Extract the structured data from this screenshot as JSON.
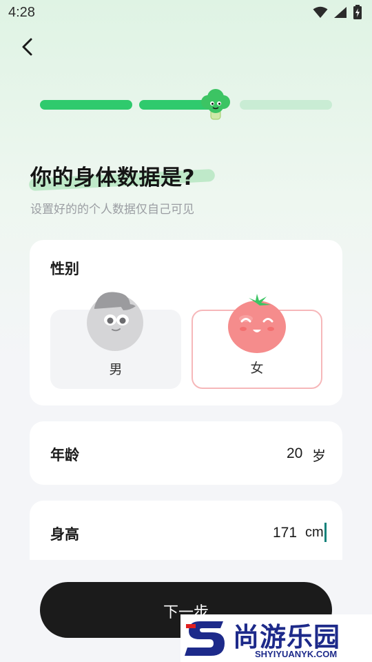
{
  "status_bar": {
    "time": "4:28"
  },
  "header": {
    "back_icon": "chevron-left-icon"
  },
  "progress": {
    "total_steps": 3,
    "current_step": 2,
    "current_step_fill": 0.8,
    "mascot_icon": "broccoli-mascot-icon"
  },
  "page": {
    "title": "你的身体数据是?",
    "subtitle": "设置好的的个人数据仅自己可见"
  },
  "gender": {
    "label": "性别",
    "options": [
      {
        "label": "男",
        "icon": "male-avatar-icon",
        "selected": false
      },
      {
        "label": "女",
        "icon": "tomato-avatar-icon",
        "selected": true
      }
    ]
  },
  "age": {
    "label": "年龄",
    "value": "20",
    "unit": "岁"
  },
  "height": {
    "label": "身高",
    "value": "171",
    "unit": "cm"
  },
  "footer": {
    "next_label": "下一步"
  },
  "watermark": {
    "brand": "尚游乐园",
    "url": "SHYIYUANYK.COM"
  },
  "colors": {
    "accent": "#2fca6d",
    "selected_border": "#f6b7b9",
    "button_bg": "#1b1b1b"
  }
}
